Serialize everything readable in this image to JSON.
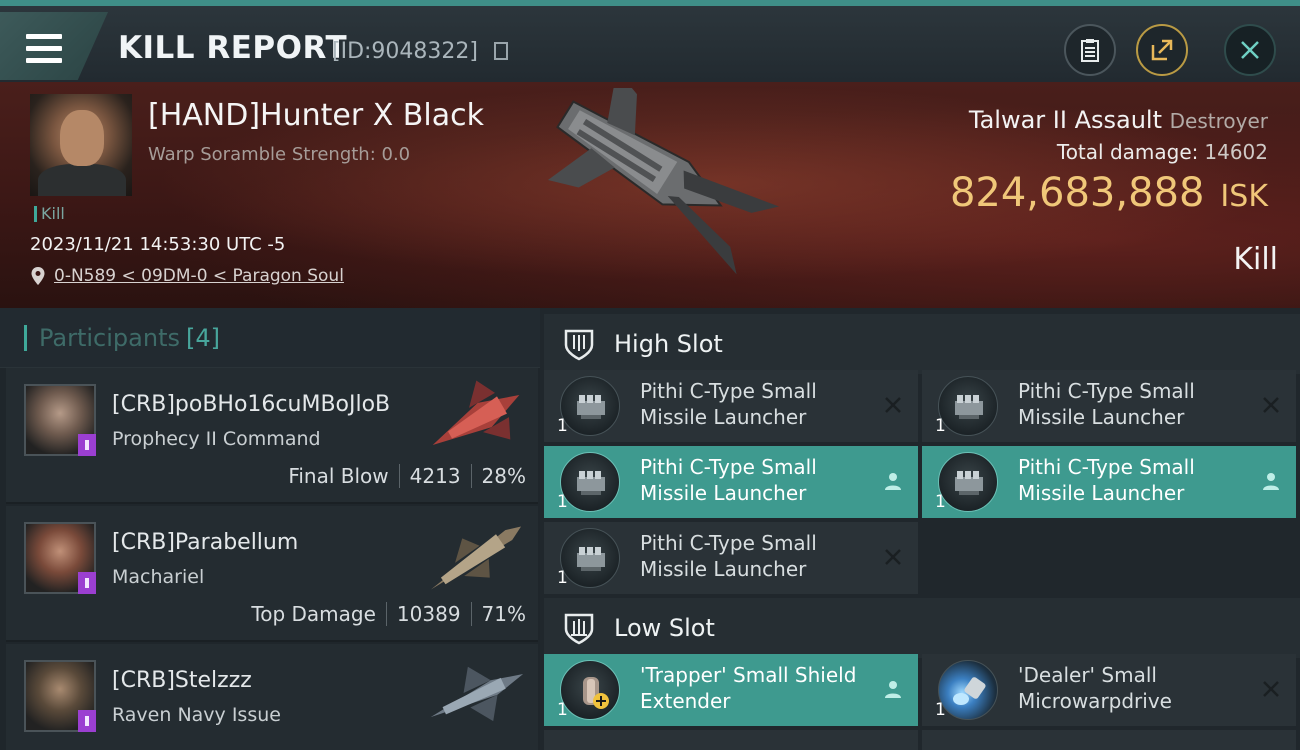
{
  "header": {
    "title": "KILL REPORT",
    "report_id": "[ID:9048322]"
  },
  "victim": {
    "name": "[HAND]Hunter X Black",
    "scramble": "Warp Soramble Strength: 0.0",
    "tag": "Kill",
    "timestamp": "2023/11/21 14:53:30 UTC -5",
    "location": "0-N589 < 09DM-0 < Paragon Soul",
    "ship_name": "Talwar II Assault",
    "ship_class": "Destroyer",
    "total_damage_label": "Total damage:",
    "total_damage": "14602",
    "isk_value": "824,683,888",
    "isk_unit": "ISK",
    "result": "Kill"
  },
  "participants": {
    "label": "Participants",
    "count": "[4]",
    "items": [
      {
        "name": "[CRB]poBHo16cuMBoJloB",
        "ship": "Prophecy II Command",
        "role": "Final Blow",
        "damage": "4213",
        "percent": "28%"
      },
      {
        "name": "[CRB]Parabellum",
        "ship": "Machariel",
        "role": "Top Damage",
        "damage": "10389",
        "percent": "71%"
      },
      {
        "name": "[CRB]Stelzzz",
        "ship": "Raven Navy Issue"
      }
    ]
  },
  "fitting": {
    "high_slot": {
      "label": "High Slot",
      "modules": [
        {
          "line1": "Pithi C-Type Small",
          "line2": "Missile Launcher",
          "qty": "1",
          "status": "destroyed"
        },
        {
          "line1": "Pithi C-Type Small",
          "line2": "Missile Launcher",
          "qty": "1",
          "status": "destroyed"
        },
        {
          "line1": "Pithi C-Type Small",
          "line2": "Missile Launcher",
          "qty": "1",
          "status": "dropped"
        },
        {
          "line1": "Pithi C-Type Small",
          "line2": "Missile Launcher",
          "qty": "1",
          "status": "dropped"
        },
        {
          "line1": "Pithi C-Type Small",
          "line2": "Missile Launcher",
          "qty": "1",
          "status": "destroyed"
        }
      ]
    },
    "low_slot": {
      "label": "Low Slot",
      "modules": [
        {
          "line1": "'Trapper' Small Shield",
          "line2": "Extender",
          "qty": "1",
          "status": "dropped"
        },
        {
          "line1": "'Dealer' Small",
          "line2": "Microwarpdrive",
          "qty": "1",
          "status": "destroyed"
        }
      ]
    }
  },
  "colors": {
    "accent": "#3fa99a",
    "active_row": "#3e9a8f",
    "isk": "#f0c779",
    "corp_badge": "#9b3fd1"
  }
}
